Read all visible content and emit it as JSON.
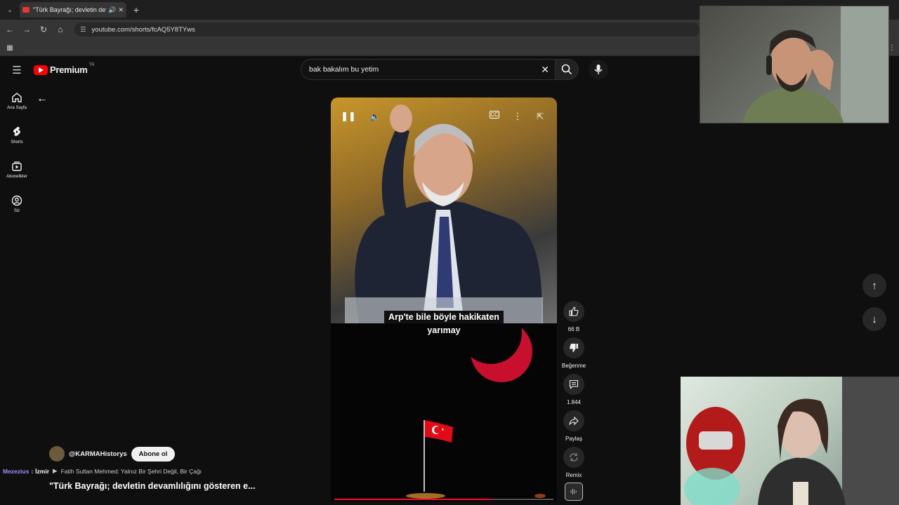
{
  "browser": {
    "tab_title": "\"Türk Bayrağı; devletin deva",
    "url": "youtube.com/shorts/fcAQ5Y8TYws"
  },
  "header": {
    "logo_text": "Premium",
    "country_code": "TR",
    "search_value": "bak bakalım bu yetim"
  },
  "sidebar": {
    "items": [
      {
        "label": "Ana Sayfa",
        "icon": "home-icon"
      },
      {
        "label": "Shorts",
        "icon": "shorts-icon"
      },
      {
        "label": "Abonelikler",
        "icon": "subscriptions-icon"
      },
      {
        "label": "Siz",
        "icon": "account-icon"
      }
    ]
  },
  "video": {
    "caption_line1": "Arp'te bile böyle hakikaten",
    "caption_line2": "yarımay",
    "progress": 0.72
  },
  "actions": {
    "like_count": "66 B",
    "dislike_label": "Beğenme",
    "comment_count": "1.844",
    "share_label": "Paylaş",
    "remix_label": "Remix"
  },
  "channel": {
    "handle": "@KARMAHistorys",
    "subscribe_label": "Abone ol"
  },
  "chat": {
    "user": "Mezezius",
    "separator": ":",
    "text": "İzmir",
    "suggestion": "Fatih Sultan Mehmed: Yalnız Bir Şehri Değil, Bir Çağı"
  },
  "title": "\"Türk Bayrağı; devletin devamlılığını gösteren e...",
  "colors": {
    "accent": "#ff0000",
    "background": "#0f0f0f",
    "moon": "#c8102e"
  }
}
